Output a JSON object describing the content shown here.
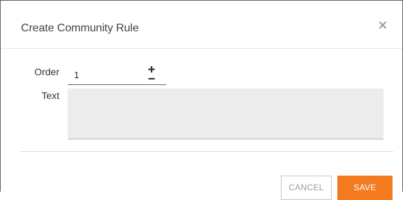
{
  "dialog": {
    "title": "Create Community Rule",
    "close_icon": "close-icon"
  },
  "form": {
    "order": {
      "label": "Order",
      "value": "1",
      "increment_icon": "plus-icon",
      "decrement_icon": "minus-icon"
    },
    "text": {
      "label": "Text",
      "value": ""
    }
  },
  "footer": {
    "cancel_label": "CANCEL",
    "save_label": "SAVE"
  },
  "colors": {
    "accent": "#f47a20",
    "text_area_bg": "#ececec",
    "border": "#5c6166"
  }
}
